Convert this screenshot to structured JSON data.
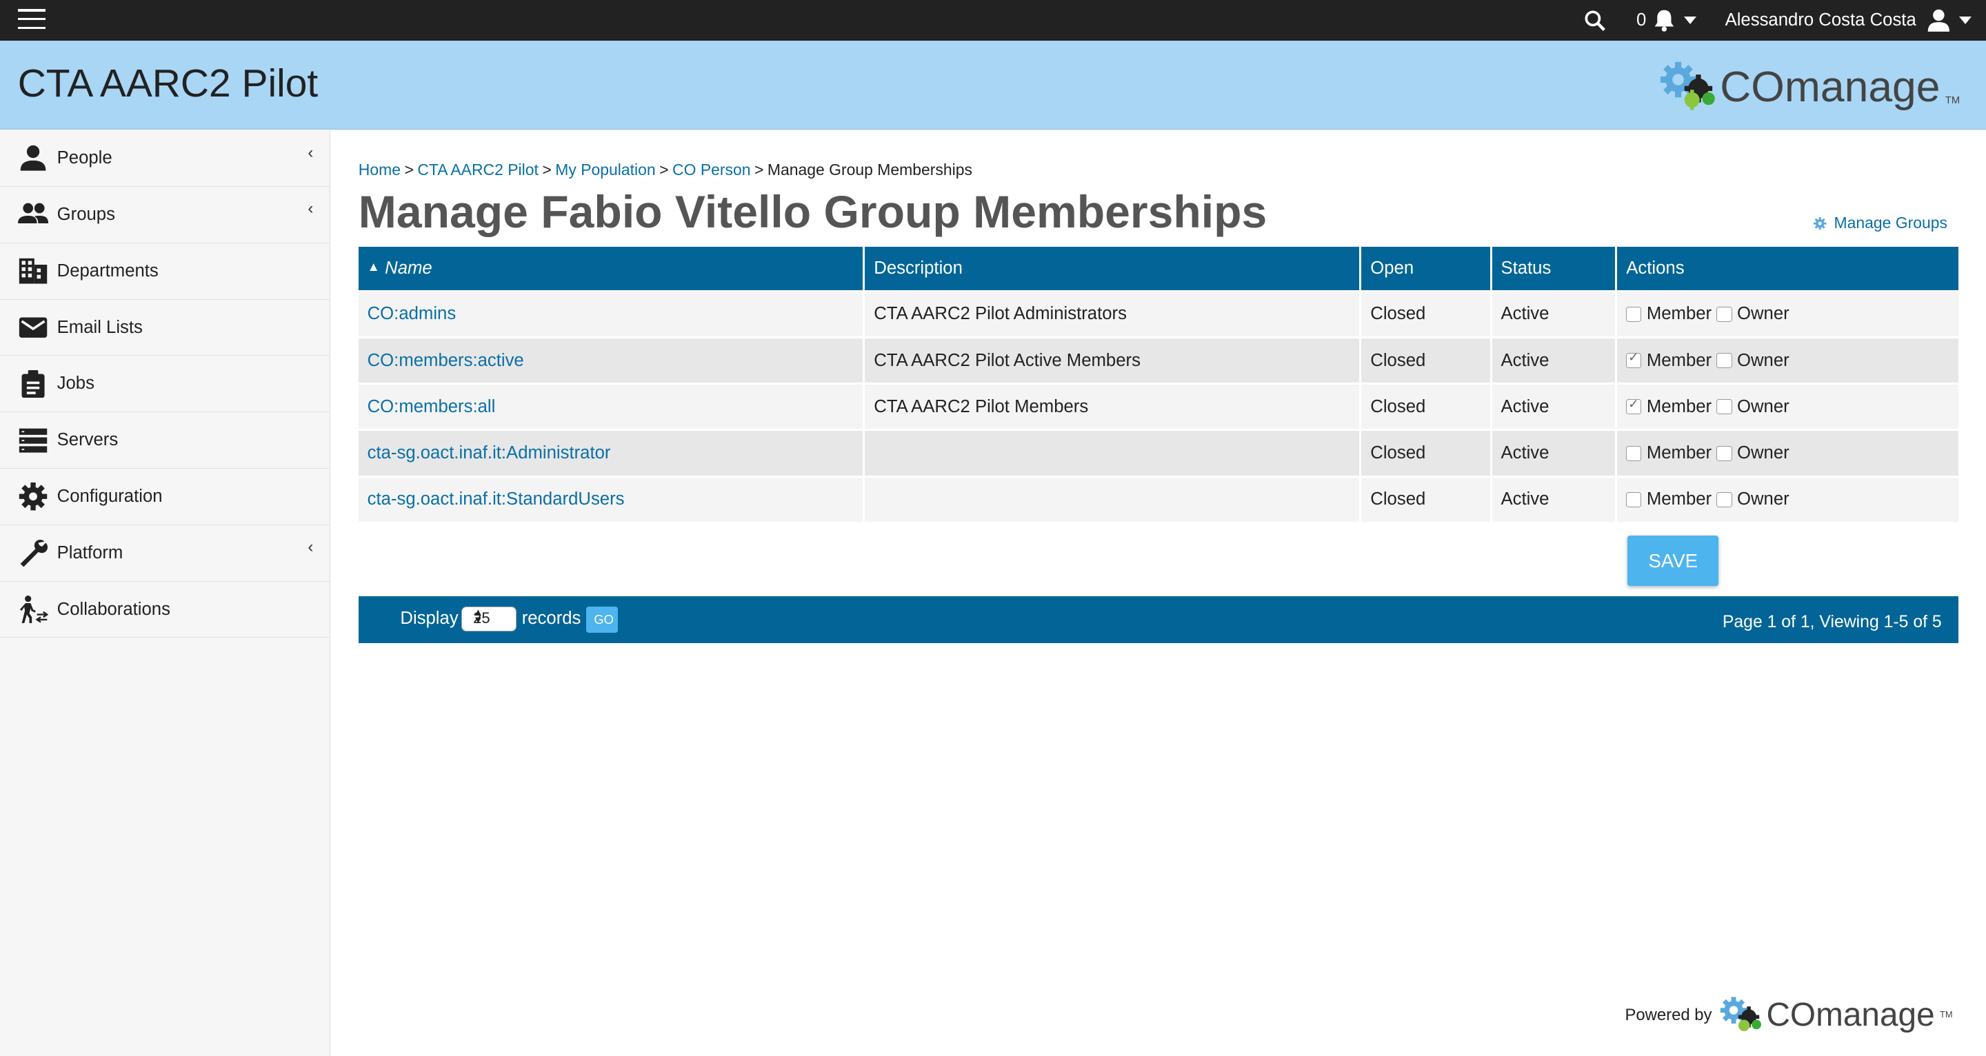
{
  "topbar": {
    "notification_count": "0",
    "user_name": "Alessandro Costa Costa",
    "icons": [
      "menu-icon",
      "search-icon",
      "bell-icon",
      "user-icon"
    ]
  },
  "header": {
    "site_title": "CTA AARC2 Pilot",
    "logo_text": "COmanage",
    "logo_tm": "TM"
  },
  "sidebar": {
    "items": [
      {
        "label": "People",
        "icon": "person-icon",
        "expandable": true
      },
      {
        "label": "Groups",
        "icon": "people-icon",
        "expandable": true
      },
      {
        "label": "Departments",
        "icon": "building-icon",
        "expandable": false
      },
      {
        "label": "Email Lists",
        "icon": "envelope-icon",
        "expandable": false
      },
      {
        "label": "Jobs",
        "icon": "clipboard-icon",
        "expandable": false
      },
      {
        "label": "Servers",
        "icon": "server-icon",
        "expandable": false
      },
      {
        "label": "Configuration",
        "icon": "gear-icon",
        "expandable": false
      },
      {
        "label": "Platform",
        "icon": "wrench-icon",
        "expandable": true
      },
      {
        "label": "Collaborations",
        "icon": "walker-icon",
        "expandable": false
      }
    ]
  },
  "breadcrumb": {
    "items": [
      "Home",
      "CTA AARC2 Pilot",
      "My Population",
      "CO Person"
    ],
    "current": "Manage Group Memberships",
    "separator": ">"
  },
  "page": {
    "title": "Manage Fabio Vitello Group Memberships",
    "manage_groups_link": "Manage Groups"
  },
  "table": {
    "columns": [
      "Name",
      "Description",
      "Open",
      "Status",
      "Actions"
    ],
    "sort_indicator": "▲",
    "member_label": "Member",
    "owner_label": "Owner",
    "rows": [
      {
        "name": "CO:admins",
        "description": "CTA AARC2 Pilot Administrators",
        "open": "Closed",
        "status": "Active",
        "member": false,
        "owner": false
      },
      {
        "name": "CO:members:active",
        "description": "CTA AARC2 Pilot Active Members",
        "open": "Closed",
        "status": "Active",
        "member": true,
        "owner": false
      },
      {
        "name": "CO:members:all",
        "description": "CTA AARC2 Pilot Members",
        "open": "Closed",
        "status": "Active",
        "member": true,
        "owner": false
      },
      {
        "name": "cta-sg.oact.inaf.it:Administrator",
        "description": "",
        "open": "Closed",
        "status": "Active",
        "member": false,
        "owner": false
      },
      {
        "name": "cta-sg.oact.inaf.it:StandardUsers",
        "description": "",
        "open": "Closed",
        "status": "Active",
        "member": false,
        "owner": false
      }
    ]
  },
  "save_label": "SAVE",
  "pager": {
    "display_label": "Display",
    "page_size": "25",
    "records_label": "records",
    "go_label": "GO",
    "status": "Page 1 of 1, Viewing 1-5 of 5"
  },
  "footer": {
    "powered_by": "Powered by",
    "logo_text": "COmanage",
    "logo_tm": "TM"
  },
  "colors": {
    "topbar": "#222222",
    "header": "#a9d6f5",
    "table_header": "#036597",
    "button": "#4db4ee",
    "link": "#0a6fa6"
  }
}
